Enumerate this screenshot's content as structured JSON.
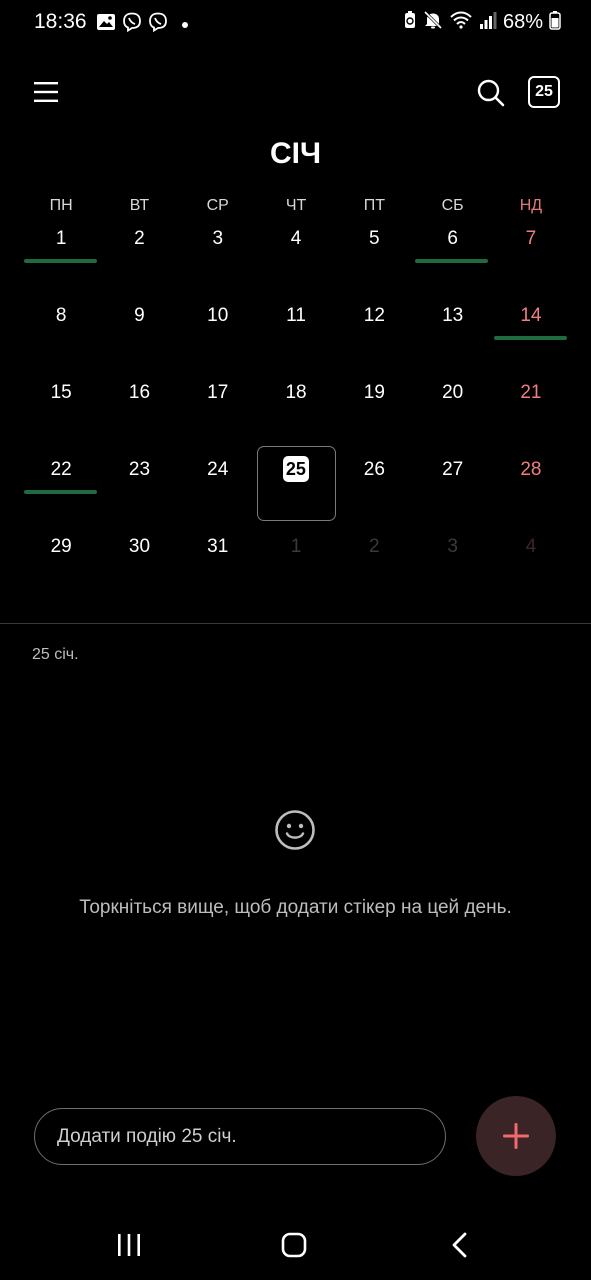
{
  "status_bar": {
    "time": "18:36",
    "battery_percent": "68%",
    "left_icons": [
      "gallery-icon",
      "viber-icon",
      "viber-icon",
      "dot-icon"
    ],
    "right_icons": [
      "battery-saver-icon",
      "mute-icon",
      "wifi-icon",
      "signal-icon",
      "battery-icon"
    ]
  },
  "toolbar": {
    "menu_icon": "menu-icon",
    "search_icon": "search-icon",
    "today_label": "25"
  },
  "calendar": {
    "month_title": "СІЧ",
    "weekdays": [
      "ПН",
      "ВТ",
      "СР",
      "ЧТ",
      "ПТ",
      "СБ",
      "НД"
    ],
    "weeks": [
      [
        "1",
        "2",
        "3",
        "4",
        "5",
        "6",
        "7"
      ],
      [
        "8",
        "9",
        "10",
        "11",
        "12",
        "13",
        "14"
      ],
      [
        "15",
        "16",
        "17",
        "18",
        "19",
        "20",
        "21"
      ],
      [
        "22",
        "23",
        "24",
        "25",
        "26",
        "27",
        "28"
      ],
      [
        "29",
        "30",
        "31",
        "1",
        "2",
        "3",
        "4"
      ]
    ],
    "selected_day": "25",
    "days_with_events": [
      "1",
      "6",
      "14",
      "22"
    ],
    "event_marker_color": "#1f6b3f",
    "sunday_color": "#f07d82"
  },
  "detail": {
    "selected_date_label": "25 січ.",
    "empty_icon": "smiley-icon",
    "empty_hint": "Торкніться вище, щоб додати стікер на цей день."
  },
  "add_event": {
    "placeholder": "Додати подію 25 січ.",
    "fab_icon": "plus-icon",
    "fab_color": "#3a2426",
    "accent": "#f06a6e"
  },
  "nav_bar": {
    "recent_icon": "recent-apps-icon",
    "home_icon": "home-icon",
    "back_icon": "back-icon"
  }
}
